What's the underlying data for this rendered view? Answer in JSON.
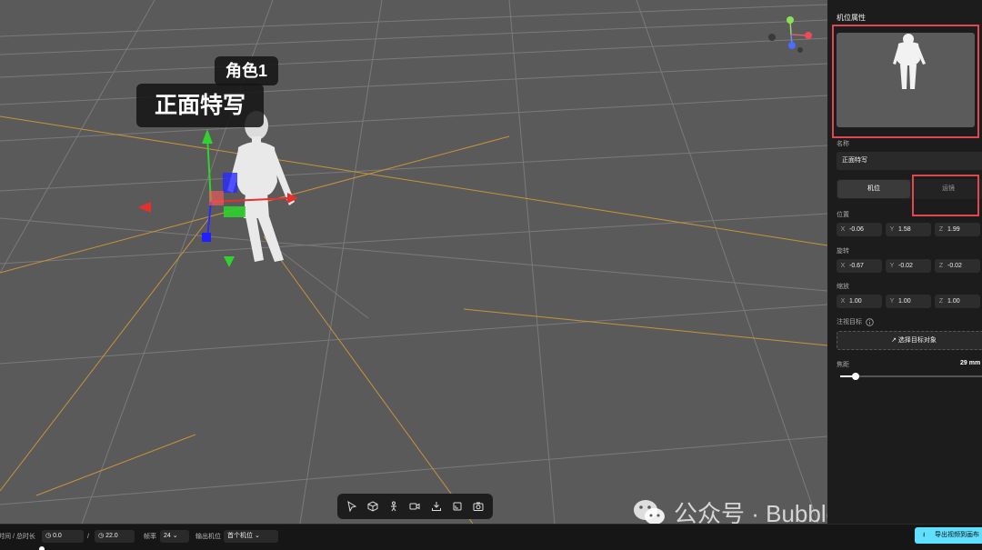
{
  "viewport": {
    "role_tag": "角色1",
    "camera_tag": "正面特写",
    "toolbar_icons": [
      "cursor-icon",
      "cube-icon",
      "person-icon",
      "camera-icon",
      "import-icon",
      "crop-icon",
      "snapshot-icon"
    ]
  },
  "watermark": {
    "text": "公众号 · BubbleBrain"
  },
  "panel": {
    "title": "机位属性",
    "name_label": "名称",
    "name_value": "正面特写",
    "tabs": [
      "机位",
      "运镜"
    ],
    "position_label": "位置",
    "position": {
      "x": "-0.06",
      "y": "1.58",
      "z": "1.99"
    },
    "rotation_label": "旋转",
    "rotation": {
      "x": "-0.67",
      "y": "-0.02",
      "z": "-0.02"
    },
    "scale_label": "缩放",
    "scale": {
      "x": "1.00",
      "y": "1.00",
      "z": "1.00"
    },
    "axis": {
      "x": "X",
      "y": "Y",
      "z": "Z"
    },
    "target_label": "注视目标",
    "target_button": "选择目标对象",
    "focal_label": "焦距",
    "focal_value": "29 mm",
    "focal_fraction": 0.1
  },
  "bottombar": {
    "time_label": "时间 / 总时长",
    "current_time": "0.0",
    "separator": "/",
    "total_time": "22.0",
    "fps_label": "帧率",
    "fps_value": "24",
    "output_label": "输出机位",
    "output_value": "首个机位",
    "export_label": "导出视频到画布"
  },
  "colors": {
    "accent": "#5fe0ff",
    "highlight_box": "#e0484d",
    "grid_orange": "#c8923a"
  }
}
